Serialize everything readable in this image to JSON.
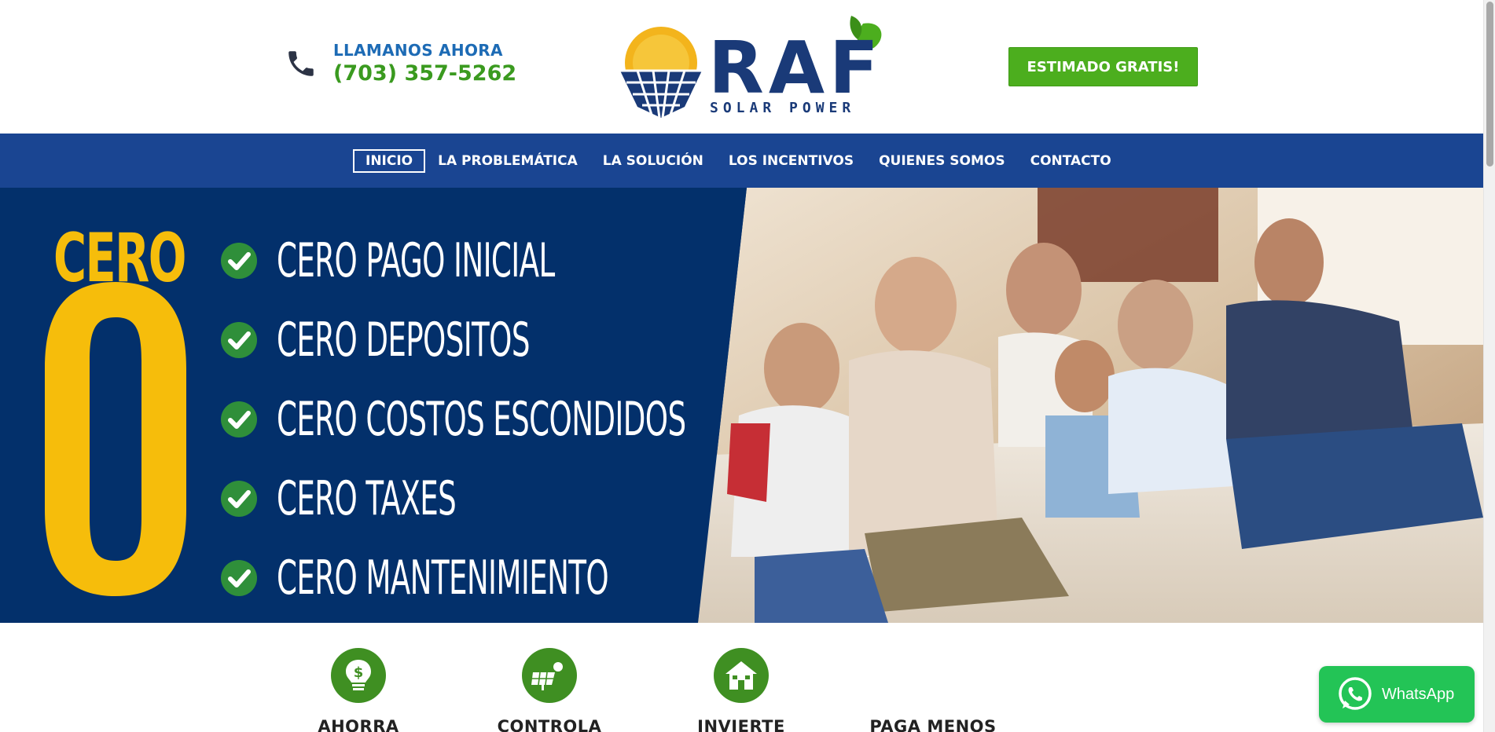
{
  "header": {
    "call_label": "LLAMANOS AHORA",
    "phone": "(703) 357-5262",
    "cta_label": "ESTIMADO GRATIS!"
  },
  "logo": {
    "brand": "RAF",
    "tagline": "SOLAR POWER",
    "colors": {
      "navy": "#1a3a78",
      "gold": "#f3b41c",
      "leaf": "#4cae1e"
    }
  },
  "nav": {
    "items": [
      {
        "label": "INICIO",
        "active": true
      },
      {
        "label": "LA PROBLEMÁTICA"
      },
      {
        "label": "LA SOLUCIÓN"
      },
      {
        "label": "LOS INCENTIVOS"
      },
      {
        "label": "QUIENES SOMOS"
      },
      {
        "label": "CONTACTO"
      }
    ]
  },
  "hero": {
    "cero_word": "CERO",
    "features": [
      "CERO PAGO INICIAL",
      "CERO DEPOSITOS",
      "CERO COSTOS ESCONDIDOS",
      "CERO TAXES",
      "CERO MANTENIMIENTO"
    ],
    "colors": {
      "panel": "#03306b",
      "accent": "#f6bd0b",
      "check": "#2f8f3a"
    }
  },
  "benefits": [
    {
      "label": "AHORRA",
      "icon": "dollar-bulb-icon"
    },
    {
      "label": "CONTROLA",
      "icon": "solar-panel-icon"
    },
    {
      "label": "INVIERTE",
      "icon": "solar-house-icon"
    },
    {
      "label": "PAGA MENOS",
      "icon": ""
    }
  ],
  "whatsapp": {
    "label": "WhatsApp"
  }
}
